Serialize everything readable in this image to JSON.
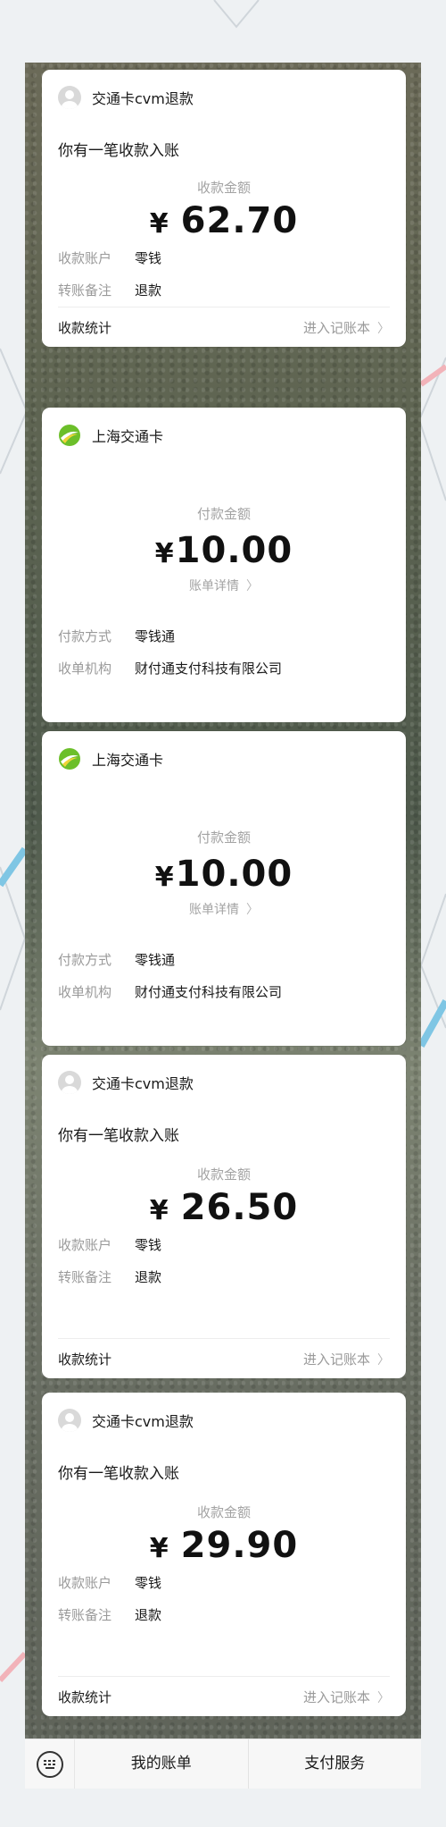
{
  "cards": [
    {
      "type": "refund",
      "title": "交通卡cvm退款",
      "lead": "你有一笔收款入账",
      "amount_label": "收款金额",
      "currency": "¥",
      "amount": "62.70",
      "rows": [
        {
          "key": "收款账户",
          "value": "零钱"
        },
        {
          "key": "转账备注",
          "value": "退款"
        }
      ],
      "footer_left": "收款统计",
      "footer_right": "进入记账本"
    },
    {
      "type": "payment",
      "title": "上海交通卡",
      "amount_label": "付款金额",
      "currency": "¥",
      "amount": "10.00",
      "detail_link": "账单详情",
      "rows": [
        {
          "key": "付款方式",
          "value": "零钱通"
        },
        {
          "key": "收单机构",
          "value": "财付通支付科技有限公司"
        }
      ]
    },
    {
      "type": "payment",
      "title": "上海交通卡",
      "amount_label": "付款金额",
      "currency": "¥",
      "amount": "10.00",
      "detail_link": "账单详情",
      "rows": [
        {
          "key": "付款方式",
          "value": "零钱通"
        },
        {
          "key": "收单机构",
          "value": "财付通支付科技有限公司"
        }
      ]
    },
    {
      "type": "refund",
      "title": "交通卡cvm退款",
      "lead": "你有一笔收款入账",
      "amount_label": "收款金额",
      "currency": "¥",
      "amount": "26.50",
      "rows": [
        {
          "key": "收款账户",
          "value": "零钱"
        },
        {
          "key": "转账备注",
          "value": "退款"
        }
      ],
      "footer_left": "收款统计",
      "footer_right": "进入记账本"
    },
    {
      "type": "refund",
      "title": "交通卡cvm退款",
      "lead": "你有一笔收款入账",
      "amount_label": "收款金额",
      "currency": "¥",
      "amount": "29.90",
      "rows": [
        {
          "key": "收款账户",
          "value": "零钱"
        },
        {
          "key": "转账备注",
          "value": "退款"
        }
      ],
      "footer_left": "收款统计",
      "footer_right": "进入记账本"
    }
  ],
  "menu": {
    "keyboard_icon": "keyboard-icon",
    "item1": "我的账单",
    "item2": "支付服务"
  },
  "colors": {
    "logo_green": "#6cbf2a",
    "logo_yellow": "#f0d43a",
    "muted": "#9a9a9a"
  }
}
